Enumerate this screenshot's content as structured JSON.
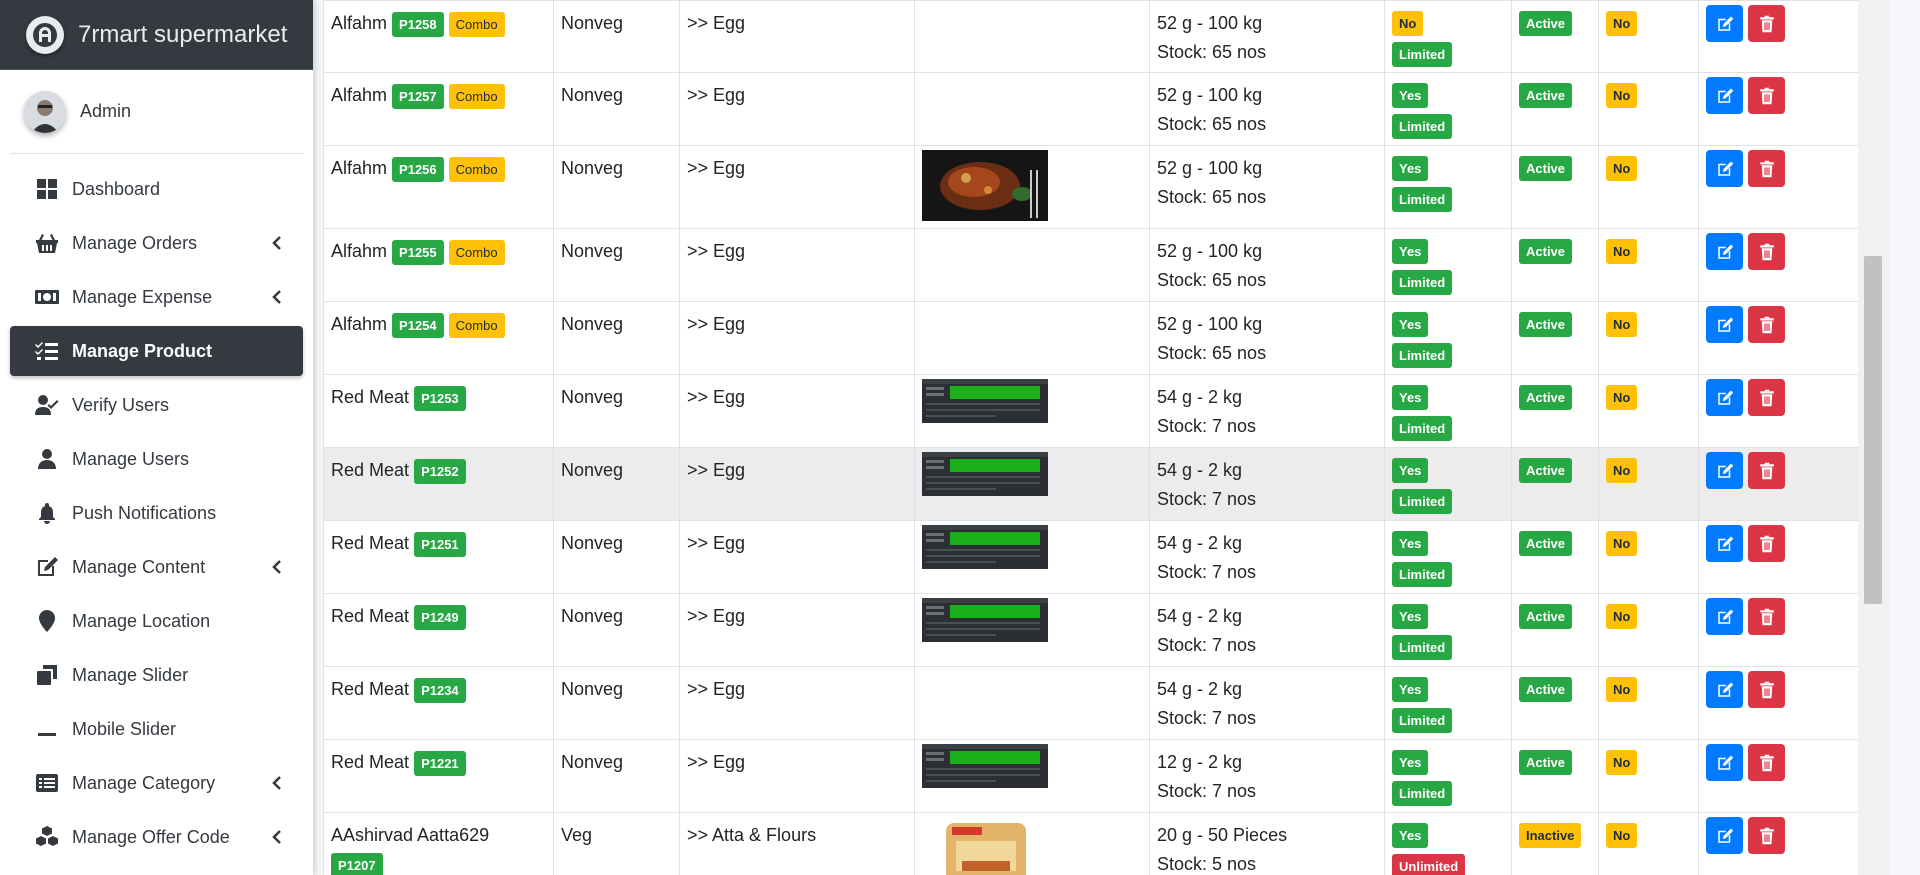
{
  "brand": {
    "title": "7rmart supermarket"
  },
  "user": {
    "name": "Admin"
  },
  "sidebar": {
    "items": [
      {
        "label": "Dashboard",
        "icon": "dashboard-icon",
        "has_chevron": false,
        "active": false
      },
      {
        "label": "Manage Orders",
        "icon": "basket-icon",
        "has_chevron": true,
        "active": false
      },
      {
        "label": "Manage Expense",
        "icon": "money-bill-icon",
        "has_chevron": true,
        "active": false
      },
      {
        "label": "Manage Product",
        "icon": "list-check-icon",
        "has_chevron": false,
        "active": true
      },
      {
        "label": "Verify Users",
        "icon": "user-check-icon",
        "has_chevron": false,
        "active": false
      },
      {
        "label": "Manage Users",
        "icon": "user-icon",
        "has_chevron": false,
        "active": false
      },
      {
        "label": "Push Notifications",
        "icon": "bell-icon",
        "has_chevron": false,
        "active": false
      },
      {
        "label": "Manage Content",
        "icon": "edit-icon",
        "has_chevron": true,
        "active": false
      },
      {
        "label": "Manage Location",
        "icon": "map-marker-icon",
        "has_chevron": false,
        "active": false
      },
      {
        "label": "Manage Slider",
        "icon": "clone-icon",
        "has_chevron": false,
        "active": false
      },
      {
        "label": "Mobile Slider",
        "icon": "minus-icon",
        "has_chevron": false,
        "active": false
      },
      {
        "label": "Manage Category",
        "icon": "list-alt-icon",
        "has_chevron": true,
        "active": false
      },
      {
        "label": "Manage Offer Code",
        "icon": "cubes-icon",
        "has_chevron": true,
        "active": false
      }
    ]
  },
  "colors": {
    "sidebar_dark": "#343a40",
    "success": "#28a745",
    "warning": "#ffc107",
    "danger": "#dc3545",
    "primary": "#007bff"
  },
  "products": [
    {
      "name": "Alfahm",
      "code": "P1258",
      "combo": "Combo",
      "type": "Nonveg",
      "category": ">> Egg",
      "image": "none",
      "weight": "52 g - 100 kg",
      "stock": "Stock: 65 nos",
      "flag": "No",
      "limit": "Limited",
      "status": "Active",
      "featured": "No"
    },
    {
      "name": "Alfahm",
      "code": "P1257",
      "combo": "Combo",
      "type": "Nonveg",
      "category": ">> Egg",
      "image": "none",
      "weight": "52 g - 100 kg",
      "stock": "Stock: 65 nos",
      "flag": "Yes",
      "limit": "Limited",
      "status": "Active",
      "featured": "No"
    },
    {
      "name": "Alfahm",
      "code": "P1256",
      "combo": "Combo",
      "type": "Nonveg",
      "category": ">> Egg",
      "image": "food",
      "weight": "52 g - 100 kg",
      "stock": "Stock: 65 nos",
      "flag": "Yes",
      "limit": "Limited",
      "status": "Active",
      "featured": "No"
    },
    {
      "name": "Alfahm",
      "code": "P1255",
      "combo": "Combo",
      "type": "Nonveg",
      "category": ">> Egg",
      "image": "none",
      "weight": "52 g - 100 kg",
      "stock": "Stock: 65 nos",
      "flag": "Yes",
      "limit": "Limited",
      "status": "Active",
      "featured": "No"
    },
    {
      "name": "Alfahm",
      "code": "P1254",
      "combo": "Combo",
      "type": "Nonveg",
      "category": ">> Egg",
      "image": "none",
      "weight": "52 g - 100 kg",
      "stock": "Stock: 65 nos",
      "flag": "Yes",
      "limit": "Limited",
      "status": "Active",
      "featured": "No"
    },
    {
      "name": "Red Meat",
      "code": "P1253",
      "combo": "",
      "type": "Nonveg",
      "category": ">> Egg",
      "image": "screen",
      "weight": "54 g - 2 kg",
      "stock": "Stock: 7 nos",
      "flag": "Yes",
      "limit": "Limited",
      "status": "Active",
      "featured": "No"
    },
    {
      "name": "Red Meat",
      "code": "P1252",
      "combo": "",
      "type": "Nonveg",
      "category": ">> Egg",
      "image": "screen",
      "weight": "54 g - 2 kg",
      "stock": "Stock: 7 nos",
      "flag": "Yes",
      "limit": "Limited",
      "status": "Active",
      "featured": "No"
    },
    {
      "name": "Red Meat",
      "code": "P1251",
      "combo": "",
      "type": "Nonveg",
      "category": ">> Egg",
      "image": "screen",
      "weight": "54 g - 2 kg",
      "stock": "Stock: 7 nos",
      "flag": "Yes",
      "limit": "Limited",
      "status": "Active",
      "featured": "No"
    },
    {
      "name": "Red Meat",
      "code": "P1249",
      "combo": "",
      "type": "Nonveg",
      "category": ">> Egg",
      "image": "screen",
      "weight": "54 g - 2 kg",
      "stock": "Stock: 7 nos",
      "flag": "Yes",
      "limit": "Limited",
      "status": "Active",
      "featured": "No"
    },
    {
      "name": "Red Meat",
      "code": "P1234",
      "combo": "",
      "type": "Nonveg",
      "category": ">> Egg",
      "image": "none",
      "weight": "54 g - 2 kg",
      "stock": "Stock: 7 nos",
      "flag": "Yes",
      "limit": "Limited",
      "status": "Active",
      "featured": "No"
    },
    {
      "name": "Red Meat",
      "code": "P1221",
      "combo": "",
      "type": "Nonveg",
      "category": ">> Egg",
      "image": "screen",
      "weight": "12 g - 2 kg",
      "stock": "Stock: 7 nos",
      "flag": "Yes",
      "limit": "Limited",
      "status": "Active",
      "featured": "No"
    },
    {
      "name": "AAshirvad Aatta629",
      "code": "P1207",
      "combo": "",
      "type": "Veg",
      "category": ">> Atta & Flours",
      "image": "bag",
      "weight": "20 g - 50 Pieces",
      "stock": "Stock: 5 nos",
      "flag": "Yes",
      "limit": "Unlimited",
      "status": "Inactive",
      "featured": "No"
    }
  ]
}
